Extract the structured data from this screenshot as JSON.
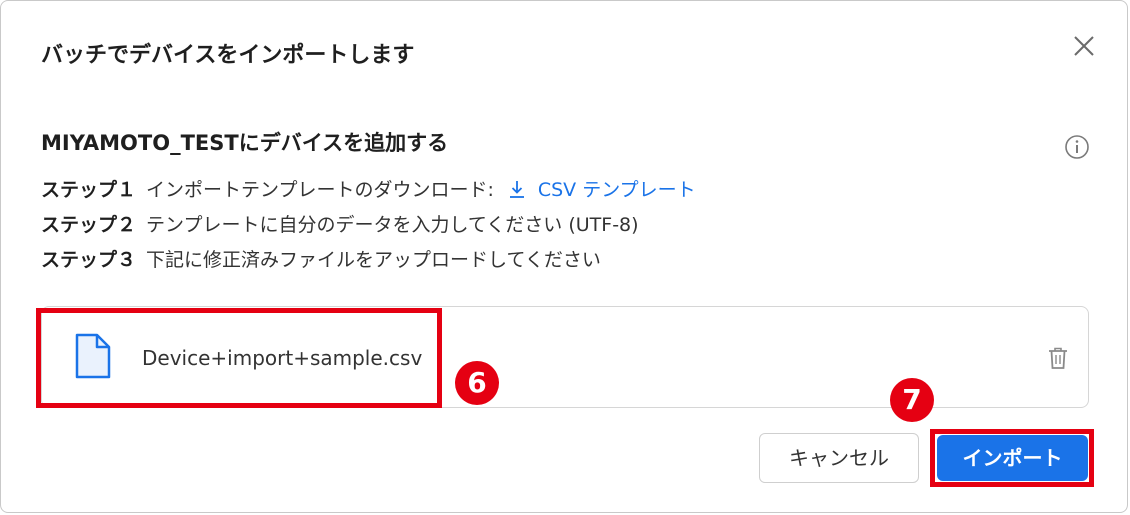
{
  "dialog": {
    "title": "バッチでデバイスをインポートします",
    "close_icon": "close-icon"
  },
  "section": {
    "title": "MIYAMOTO_TESTにデバイスを追加する",
    "info_icon": "info-icon"
  },
  "steps": [
    {
      "label": "ステップ１",
      "text": "インポートテンプレートのダウンロード:",
      "link": "CSV テンプレート",
      "link_icon": "download-icon"
    },
    {
      "label": "ステップ２",
      "text": "テンプレートに自分のデータを入力してください (UTF-8)"
    },
    {
      "label": "ステップ３",
      "text": "下記に修正済みファイルをアップロードしてください"
    }
  ],
  "file": {
    "name": "Device+import+sample.csv",
    "icon": "file-icon",
    "delete_icon": "trash-icon"
  },
  "annotations": {
    "file_marker": "6",
    "import_marker": "7",
    "highlight_color": "#e50012"
  },
  "buttons": {
    "cancel": "キャンセル",
    "import": "インポート"
  },
  "colors": {
    "accent": "#1a73e8",
    "highlight": "#e50012"
  }
}
